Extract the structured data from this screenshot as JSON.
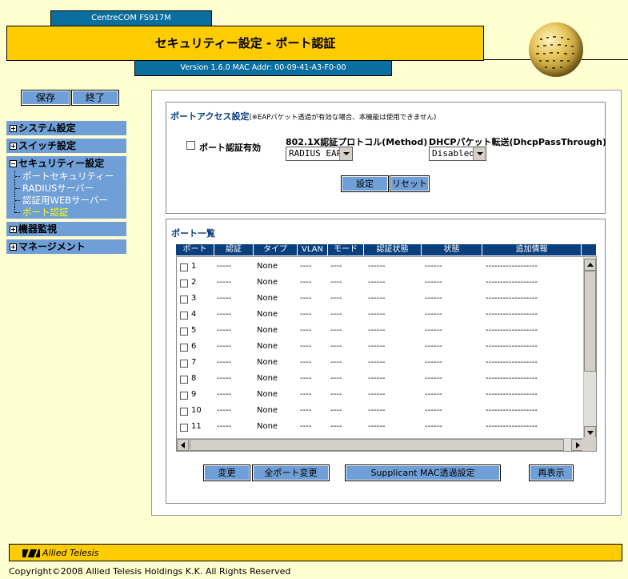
{
  "header": {
    "product": "CentreCOM FS917M",
    "title": "セキュリティー設定 - ポート認証",
    "version": "Version 1.6.0 MAC Addr: 00-09-41-A3-F0-00"
  },
  "top_buttons": {
    "save": "保存",
    "exit": "終了"
  },
  "nav": {
    "system": "システム設定",
    "switch": "スイッチ設定",
    "security": "セキュリティー設定",
    "security_items": [
      "ポートセキュリティー",
      "RADIUSサーバー",
      "認証用WEBサーバー",
      "ポート認証"
    ],
    "monitor": "機器監視",
    "management": "マネージメント"
  },
  "port_access": {
    "title": "ポートアクセス設定",
    "note": "(※EAPパケット透過が有効な場合、本機能は使用できません)",
    "enable_label": "ポート認証有効",
    "protocol_label": "802.1X認証プロトコル(Method)",
    "protocol_value": "RADIUS EAP",
    "dhcp_label": "DHCPパケット転送(DhcpPassThrough)",
    "dhcp_value": "Disabled",
    "set_button": "設定",
    "reset_button": "リセット"
  },
  "port_list": {
    "title": "ポート一覧",
    "columns": [
      "ポート",
      "認証",
      "タイプ",
      "VLAN",
      "モード",
      "認証状態",
      "状態",
      "追加情報"
    ],
    "rows": [
      {
        "port": "1",
        "auth": "-----",
        "type": "None",
        "vlan": "----",
        "mode": "----",
        "auth_state": "------",
        "state": "------",
        "info": "------------------"
      },
      {
        "port": "2",
        "auth": "-----",
        "type": "None",
        "vlan": "----",
        "mode": "----",
        "auth_state": "------",
        "state": "------",
        "info": "------------------"
      },
      {
        "port": "3",
        "auth": "-----",
        "type": "None",
        "vlan": "----",
        "mode": "----",
        "auth_state": "------",
        "state": "------",
        "info": "------------------"
      },
      {
        "port": "4",
        "auth": "-----",
        "type": "None",
        "vlan": "----",
        "mode": "----",
        "auth_state": "------",
        "state": "------",
        "info": "------------------"
      },
      {
        "port": "5",
        "auth": "-----",
        "type": "None",
        "vlan": "----",
        "mode": "----",
        "auth_state": "------",
        "state": "------",
        "info": "------------------"
      },
      {
        "port": "6",
        "auth": "-----",
        "type": "None",
        "vlan": "----",
        "mode": "----",
        "auth_state": "------",
        "state": "------",
        "info": "------------------"
      },
      {
        "port": "7",
        "auth": "-----",
        "type": "None",
        "vlan": "----",
        "mode": "----",
        "auth_state": "------",
        "state": "------",
        "info": "------------------"
      },
      {
        "port": "8",
        "auth": "-----",
        "type": "None",
        "vlan": "----",
        "mode": "----",
        "auth_state": "------",
        "state": "------",
        "info": "------------------"
      },
      {
        "port": "9",
        "auth": "-----",
        "type": "None",
        "vlan": "----",
        "mode": "----",
        "auth_state": "------",
        "state": "------",
        "info": "------------------"
      },
      {
        "port": "10",
        "auth": "-----",
        "type": "None",
        "vlan": "----",
        "mode": "----",
        "auth_state": "------",
        "state": "------",
        "info": "------------------"
      },
      {
        "port": "11",
        "auth": "-----",
        "type": "None",
        "vlan": "----",
        "mode": "----",
        "auth_state": "------",
        "state": "------",
        "info": "------------------"
      }
    ],
    "buttons": {
      "change": "変更",
      "change_all": "全ポート変更",
      "supplicant": "Supplicant MAC透過設定",
      "refresh": "再表示"
    }
  },
  "footer": {
    "brand": "Allied Telesis",
    "copyright": "Copyright©2008 Allied Telesis Holdings K.K. All Rights Reserved"
  },
  "colors": {
    "accent_yellow": "#ffcc00",
    "nav_blue": "#6f9fd6",
    "header_blue": "#0a6f9e",
    "background": "#ffffd2"
  }
}
